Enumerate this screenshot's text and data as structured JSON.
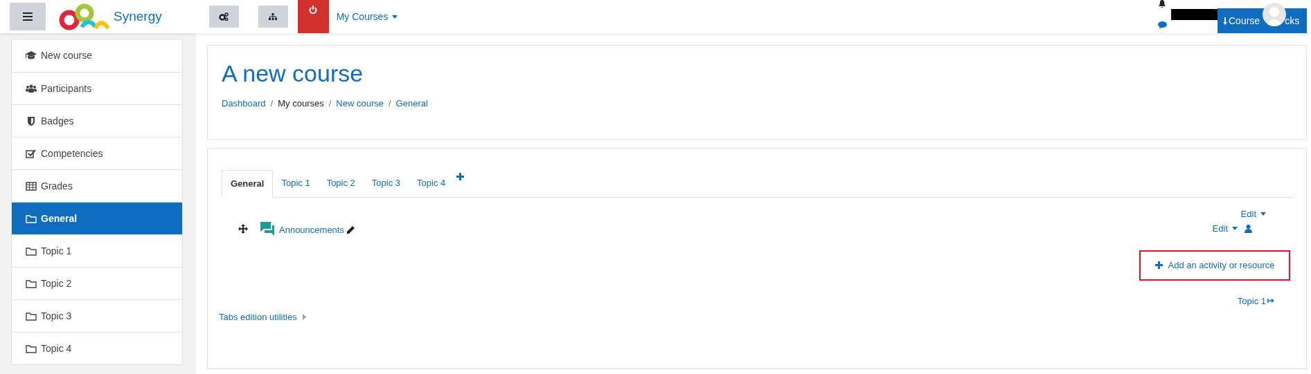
{
  "navbar": {
    "site_name": "Synergy",
    "menu": "My Courses",
    "course_blocks_start": "Course",
    "course_blocks_end": "cks"
  },
  "sidebar": {
    "items": [
      {
        "label": "New course",
        "kind": "course",
        "selected": false
      },
      {
        "label": "Participants",
        "kind": "participants",
        "selected": false
      },
      {
        "label": "Badges",
        "kind": "badges",
        "selected": false
      },
      {
        "label": "Competencies",
        "kind": "competencies",
        "selected": false
      },
      {
        "label": "Grades",
        "kind": "grades",
        "selected": false
      },
      {
        "label": "General",
        "kind": "section",
        "selected": true
      },
      {
        "label": "Topic 1",
        "kind": "section",
        "selected": false
      },
      {
        "label": "Topic 2",
        "kind": "section",
        "selected": false
      },
      {
        "label": "Topic 3",
        "kind": "section",
        "selected": false
      },
      {
        "label": "Topic 4",
        "kind": "section",
        "selected": false
      }
    ]
  },
  "header": {
    "title": "A new course",
    "breadcrumb": [
      {
        "label": "Dashboard",
        "kind": "link"
      },
      {
        "label": "/",
        "kind": "separator"
      },
      {
        "label": "My courses",
        "kind": "current"
      },
      {
        "label": "/",
        "kind": "separator"
      },
      {
        "label": "New course",
        "kind": "link"
      },
      {
        "label": "/",
        "kind": "separator"
      },
      {
        "label": "General",
        "kind": "link"
      }
    ]
  },
  "tabs": [
    {
      "label": "General",
      "selected": true
    },
    {
      "label": "Topic 1",
      "selected": false
    },
    {
      "label": "Topic 2",
      "selected": false
    },
    {
      "label": "Topic 3",
      "selected": false
    },
    {
      "label": "Topic 4",
      "selected": false
    }
  ],
  "section": {
    "edit": "Edit",
    "activity": {
      "name": "Announcements",
      "edit": "Edit"
    },
    "add": "Add an activity or resource",
    "next": "Topic 1",
    "utilities": "Tabs edition utilities"
  }
}
